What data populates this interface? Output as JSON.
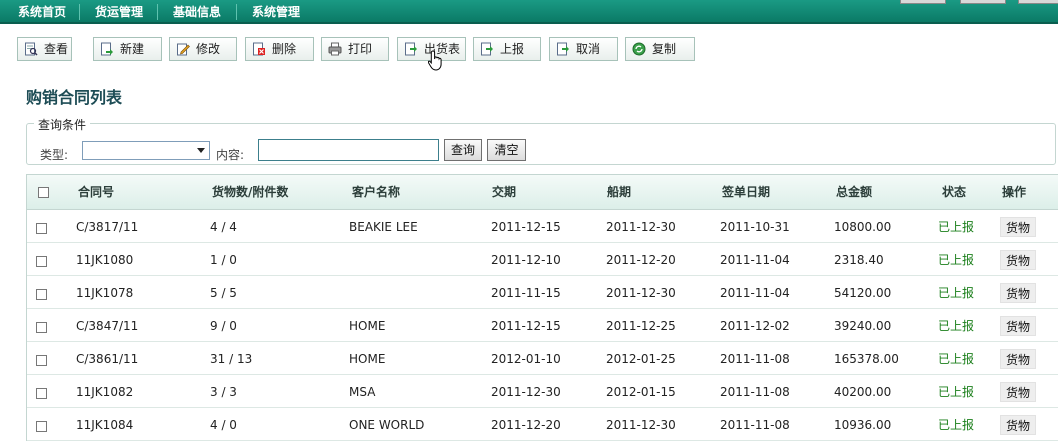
{
  "nav": {
    "items": [
      "系统首页",
      "货运管理",
      "基础信息",
      "系统管理"
    ]
  },
  "toolbar": {
    "buttons": [
      {
        "label": "查看",
        "icon": "view-icon"
      },
      {
        "label": "新建",
        "icon": "new-icon"
      },
      {
        "label": "修改",
        "icon": "edit-icon"
      },
      {
        "label": "删除",
        "icon": "delete-icon"
      },
      {
        "label": "打印",
        "icon": "print-icon"
      },
      {
        "label": "出货表",
        "icon": "export-icon"
      },
      {
        "label": "上报",
        "icon": "report-icon"
      },
      {
        "label": "取消",
        "icon": "cancel-icon"
      },
      {
        "label": "复制",
        "icon": "copy-icon"
      }
    ]
  },
  "page": {
    "title": "购销合同列表"
  },
  "query": {
    "legend": "查询条件",
    "type_label": "类型:",
    "type_value": "",
    "content_label": "内容:",
    "content_value": "",
    "search_label": "查询",
    "clear_label": "清空"
  },
  "table": {
    "headers": [
      "合同号",
      "货物数/附件数",
      "客户名称",
      "交期",
      "船期",
      "签单日期",
      "总金额",
      "状态",
      "操作"
    ],
    "rows": [
      {
        "contract_no": "C/3817/11",
        "counts": "4 / 4",
        "customer": "BEAKIE LEE",
        "delivery": "2011-12-15",
        "shipping": "2011-12-30",
        "signed": "2011-10-31",
        "amount": "10800.00",
        "status": "已上报",
        "action": "货物"
      },
      {
        "contract_no": "11JK1080",
        "counts": "1 / 0",
        "customer": "",
        "delivery": "2011-12-10",
        "shipping": "2011-12-20",
        "signed": "2011-11-04",
        "amount": "2318.40",
        "status": "已上报",
        "action": "货物"
      },
      {
        "contract_no": "11JK1078",
        "counts": "5 / 5",
        "customer": "",
        "delivery": "2011-11-15",
        "shipping": "2011-12-30",
        "signed": "2011-11-04",
        "amount": "54120.00",
        "status": "已上报",
        "action": "货物"
      },
      {
        "contract_no": "C/3847/11",
        "counts": "9 / 0",
        "customer": "HOME",
        "delivery": "2011-12-15",
        "shipping": "2011-12-25",
        "signed": "2011-12-02",
        "amount": "39240.00",
        "status": "已上报",
        "action": "货物"
      },
      {
        "contract_no": "C/3861/11",
        "counts": "31 / 13",
        "customer": "HOME",
        "delivery": "2012-01-10",
        "shipping": "2012-01-25",
        "signed": "2011-11-08",
        "amount": "165378.00",
        "status": "已上报",
        "action": "货物"
      },
      {
        "contract_no": "11JK1082",
        "counts": "3 / 3",
        "customer": "MSA",
        "delivery": "2011-12-30",
        "shipping": "2012-01-15",
        "signed": "2011-11-08",
        "amount": "40200.00",
        "status": "已上报",
        "action": "货物"
      },
      {
        "contract_no": "11JK1084",
        "counts": "4 / 0",
        "customer": "ONE WORLD",
        "delivery": "2011-12-20",
        "shipping": "2011-12-30",
        "signed": "2011-11-08",
        "amount": "10936.00",
        "status": "已上报",
        "action": "货物"
      }
    ]
  },
  "colors": {
    "nav_bg": "#0b7a66",
    "status_green": "#1b7f1b",
    "title": "#1d4c55"
  }
}
